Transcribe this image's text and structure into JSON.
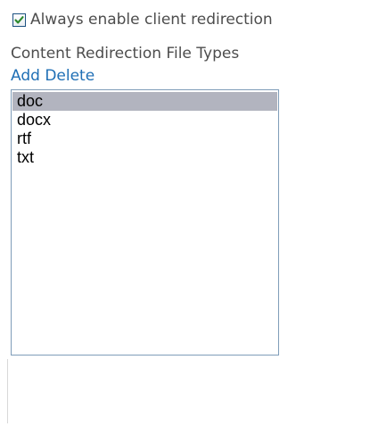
{
  "options": {
    "always_enable_redirection": {
      "label": "Always enable client redirection",
      "checked": true
    }
  },
  "file_types": {
    "label": "Content Redirection File Types",
    "add_label": "Add",
    "delete_label": "Delete",
    "items": [
      "doc",
      "docx",
      "rtf",
      "txt"
    ],
    "selected": "doc"
  },
  "colors": {
    "link": "#1f6fb5",
    "selection": "#b2b4bf",
    "checkmark": "#2f8a2f",
    "listbox_border": "#7f9db9"
  },
  "icons": {
    "checkbox_mark": "checkmark-icon"
  }
}
